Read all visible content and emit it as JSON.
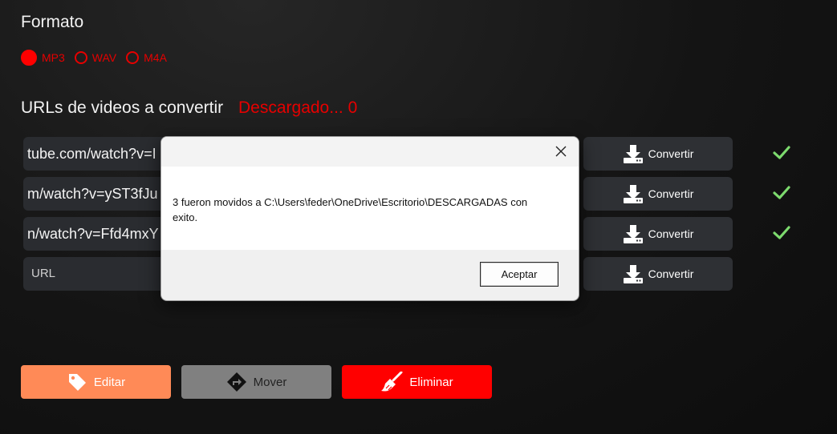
{
  "format": {
    "title": "Formato",
    "options": [
      {
        "label": "MP3",
        "selected": true
      },
      {
        "label": "WAV",
        "selected": false
      },
      {
        "label": "M4A",
        "selected": false
      }
    ]
  },
  "urls": {
    "title": "URLs de videos a convertir",
    "status": "Descargado... 0",
    "rows": [
      {
        "value": "tube.com/watch?v=I",
        "button": "Convertir",
        "done": true
      },
      {
        "value": "m/watch?v=yST3fJu",
        "button": "Convertir",
        "done": true
      },
      {
        "value": "n/watch?v=Ffd4mxY",
        "button": "Convertir",
        "done": true
      },
      {
        "value": "",
        "placeholder": "URL",
        "button": "Convertir",
        "done": false
      }
    ]
  },
  "actions": {
    "edit": "Editar",
    "move": "Mover",
    "delete": "Eliminar"
  },
  "dialog": {
    "message": "3 fueron movidos a C:\\Users\\feder\\OneDrive\\Escritorio\\DESCARGADAS con exito.",
    "ok": "Aceptar"
  },
  "colors": {
    "accent": "#ff0000",
    "edit": "#ff8a57",
    "move": "#808080",
    "check": "#7ddb6e"
  }
}
